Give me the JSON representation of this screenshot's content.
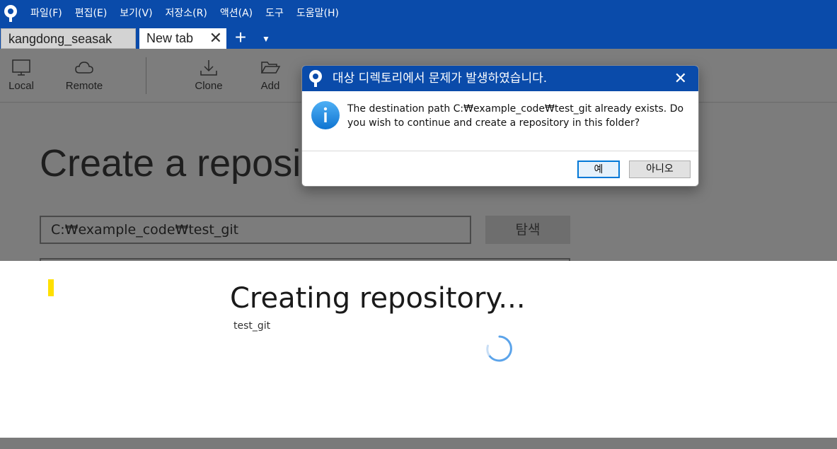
{
  "menu": {
    "items": [
      "파일(F)",
      "편집(E)",
      "보기(V)",
      "저장소(R)",
      "액션(A)",
      "도구",
      "도움말(H)"
    ]
  },
  "tabs": {
    "items": [
      {
        "label": "kangdong_seasak",
        "active": false
      },
      {
        "label": "New tab",
        "active": true
      }
    ],
    "close_glyph": "✕",
    "add_glyph": "+",
    "more_glyph": "▼"
  },
  "toolbar": {
    "local_label": "Local",
    "remote_label": "Remote",
    "clone_label": "Clone",
    "add_label": "Add"
  },
  "main": {
    "heading": "Create a reposit",
    "path_value": "C:₩example_code₩test_git",
    "browse_label": "탐색"
  },
  "progress": {
    "title": "Creating repository...",
    "subtitle": "test_git"
  },
  "dialog": {
    "title": "대상 디렉토리에서 문제가 발생하였습니다.",
    "message": "The destination path C:₩example_code₩test_git already exists. Do you wish to continue and create a repository in this folder?",
    "yes_label": "예",
    "no_label": "아니오",
    "close_glyph": "✕"
  },
  "colors": {
    "brand_blue": "#0a4baa",
    "info_blue": "#1a8fe3",
    "focus_blue": "#0078d7",
    "marker_yellow": "#ffe000"
  },
  "icons": [
    "sourcetree-logo-icon",
    "monitor-icon",
    "cloud-icon",
    "download-icon",
    "folder-open-icon",
    "info-icon",
    "close-icon",
    "spinner-icon"
  ]
}
